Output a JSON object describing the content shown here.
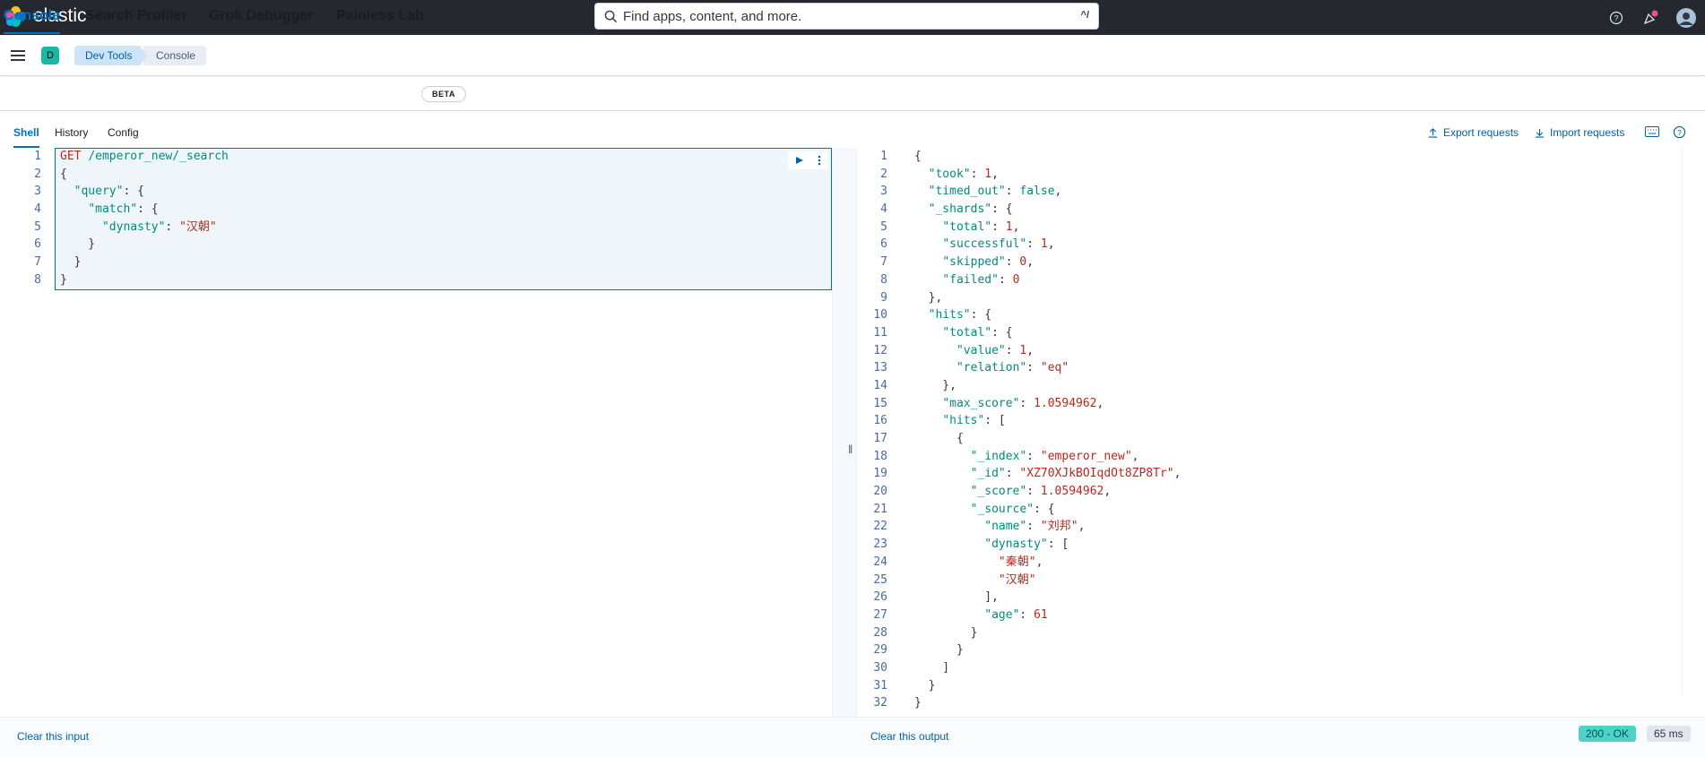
{
  "app": {
    "brand": "elastic"
  },
  "search": {
    "placeholder": "Find apps, content, and more.",
    "shortcut": "^/"
  },
  "space": {
    "initial": "D"
  },
  "breadcrumb": {
    "first": "Dev Tools",
    "second": "Console"
  },
  "tabs": [
    "Console",
    "Search Profiler",
    "Grok Debugger",
    "Painless Lab"
  ],
  "beta_label": "BETA",
  "panel_tabs": [
    "Shell",
    "History",
    "Config"
  ],
  "actions": {
    "export": "Export requests",
    "import": "Import requests"
  },
  "request_lines": [
    "1",
    "2",
    "3",
    "4",
    "5",
    "6",
    "7",
    "8"
  ],
  "response_lines": [
    "1",
    "2",
    "3",
    "4",
    "5",
    "6",
    "7",
    "8",
    "9",
    "10",
    "11",
    "12",
    "13",
    "14",
    "15",
    "16",
    "17",
    "18",
    "19",
    "20",
    "21",
    "22",
    "23",
    "24",
    "25",
    "26",
    "27",
    "28",
    "29",
    "30",
    "31",
    "32"
  ],
  "request": {
    "method": "GET",
    "path": "/emperor_new/_search",
    "query_key": "\"query\"",
    "match_key": "\"match\"",
    "field_key": "\"dynasty\"",
    "field_value": "\"汉朝\""
  },
  "response": {
    "took": "1",
    "timed_out": "false",
    "shards_total": "1",
    "shards_successful": "1",
    "shards_skipped": "0",
    "shards_failed": "0",
    "hits_total_value": "1",
    "hits_total_relation": "\"eq\"",
    "max_score": "1.0594962",
    "hit_index": "\"emperor_new\"",
    "hit_id": "\"XZ70XJkBOIqdOt8ZP8Tr\"",
    "hit_score": "1.0594962",
    "source_name": "\"刘邦\"",
    "source_dynasty_1": "\"秦朝\"",
    "source_dynasty_2": "\"汉朝\"",
    "source_age": "61"
  },
  "footer": {
    "clear_input": "Clear this input",
    "clear_output": "Clear this output",
    "status": "200 - OK",
    "time": "65 ms"
  },
  "colors": {
    "accent": "#0071c2",
    "success": "#4dd2ca",
    "header": "#25282f"
  }
}
